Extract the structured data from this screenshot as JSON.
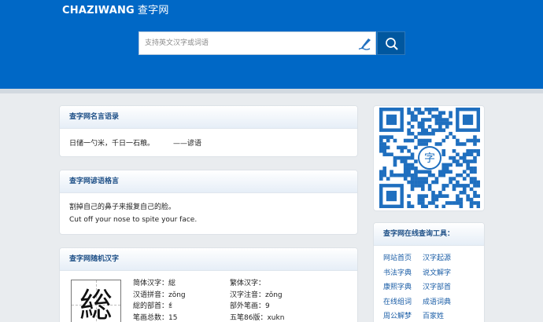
{
  "header": {
    "brand_en": "CHAZIWANG",
    "brand_cn": "查字网"
  },
  "search": {
    "placeholder": "支持英文汉字或词语",
    "brush_icon": "brush-icon",
    "button_icon": "search-icon"
  },
  "quote_card": {
    "title": "查字网名言语录",
    "text": "日储一勺米，千日一石粮。",
    "author": "——谚语"
  },
  "idiom_card": {
    "title": "查字网谚语格言",
    "line_cn": "割掉自己的鼻子来报复自己的脸。",
    "line_en": "Cut off your nose to spite your face."
  },
  "random_char_card": {
    "title": "查字网随机汉字",
    "character": "総",
    "left_fields": [
      "简体汉字：総",
      "汉语拼音：zǒng",
      "総的部首：纟",
      "笔画总数：15"
    ],
    "right_fields": [
      "繁体汉字：",
      "汉字注音：zǒng",
      "部外笔画：9",
      "五笔86版：xukn"
    ]
  },
  "qr": {
    "center_glyph": "字"
  },
  "tools_card": {
    "title": "查字网在线查询工具：",
    "links": [
      "网站首页",
      "汉字起源",
      "书法字典",
      "说文解字",
      "康熙字典",
      "汉字部首",
      "在线组词",
      "成语词典",
      "周公解梦",
      "百家姓"
    ]
  },
  "colors": {
    "header_blue": "#0068c6",
    "card_title": "#1d4f87",
    "link": "#1a5da6"
  }
}
